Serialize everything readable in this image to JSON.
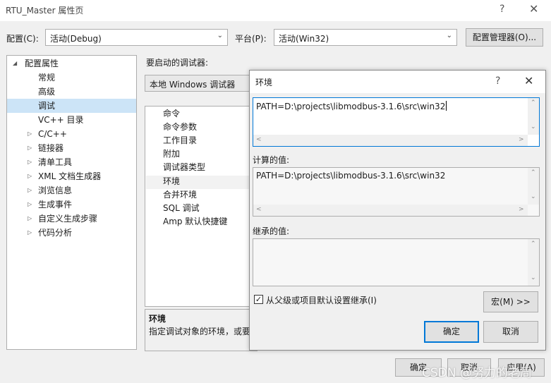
{
  "window": {
    "title": "RTU_Master 属性页",
    "help_icon": "?",
    "close_icon": "✕"
  },
  "config": {
    "config_label": "配置(C):",
    "config_value": "活动(Debug)",
    "platform_label": "平台(P):",
    "platform_value": "活动(Win32)",
    "manager_button": "配置管理器(O)..."
  },
  "tree": {
    "root": "配置属性",
    "items": [
      {
        "label": "常规"
      },
      {
        "label": "高级"
      },
      {
        "label": "调试",
        "selected": true
      },
      {
        "label": "VC++ 目录"
      },
      {
        "label": "C/C++"
      },
      {
        "label": "链接器"
      },
      {
        "label": "清单工具"
      },
      {
        "label": "XML 文档生成器"
      },
      {
        "label": "浏览信息"
      },
      {
        "label": "生成事件"
      },
      {
        "label": "自定义生成步骤"
      },
      {
        "label": "代码分析"
      }
    ]
  },
  "debugger": {
    "label": "要启动的调试器:",
    "value": "本地 Windows 调试器"
  },
  "properties": {
    "items": [
      "命令",
      "命令参数",
      "工作目录",
      "附加",
      "调试器类型",
      "环境",
      "合并环境",
      "SQL 调试",
      "Amp 默认快捷键"
    ]
  },
  "description": {
    "title": "环境",
    "text": "指定调试对象的环境，或要"
  },
  "dialog": {
    "title": "环境",
    "help_icon": "?",
    "close_icon": "✕",
    "edit_value": "PATH=D:\\projects\\libmodbus-3.1.6\\src\\win32",
    "computed_label": "计算的值:",
    "computed_value": "PATH=D:\\projects\\libmodbus-3.1.6\\src\\win32",
    "inherited_label": "继承的值:",
    "inherit_checkbox_label": "从父级或项目默认设置继承(I)",
    "inherit_checked": true,
    "macros_button": "宏(M) >>",
    "ok_button": "确定",
    "cancel_button": "取消"
  },
  "bottom": {
    "ok_button": "确定",
    "cancel_button": "取消",
    "apply_button": "应用(A)"
  },
  "watermark": "CSDN @努力的老周"
}
